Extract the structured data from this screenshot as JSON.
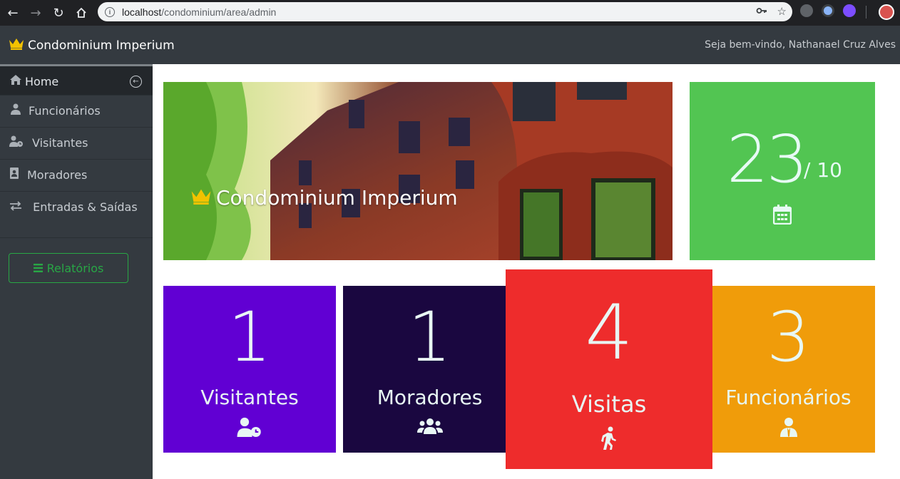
{
  "browser": {
    "url_host": "localhost",
    "url_path": "/condominium/area/admin"
  },
  "app": {
    "brand": "Condominium Imperium",
    "welcome": "Seja bem-vindo,  Nathanael Cruz Alves"
  },
  "sidebar": {
    "items": [
      {
        "label": "Home",
        "icon": "home-icon"
      },
      {
        "label": "Funcionários",
        "icon": "user-tie-icon"
      },
      {
        "label": "Visitantes",
        "icon": "user-clock-icon"
      },
      {
        "label": "Moradores",
        "icon": "address-book-icon"
      },
      {
        "label": "Entradas & Saídas",
        "icon": "exchange-icon"
      }
    ],
    "report_button": "Relatórios"
  },
  "hero": {
    "title": "Condominium Imperium"
  },
  "date_card": {
    "day": "23",
    "month": "/ 10",
    "color": "#52c552"
  },
  "stats": [
    {
      "value": "1",
      "label": "Visitantes",
      "color": "#6100d3",
      "icon": "user-clock-icon"
    },
    {
      "value": "1",
      "label": "Moradores",
      "color": "#1a0740",
      "icon": "users-icon"
    },
    {
      "value": "4",
      "label": "Visitas",
      "color": "#ee2c2c",
      "icon": "walking-icon"
    },
    {
      "value": "3",
      "label": "Funcionários",
      "color": "#f09c0a",
      "icon": "user-tie-icon"
    }
  ]
}
